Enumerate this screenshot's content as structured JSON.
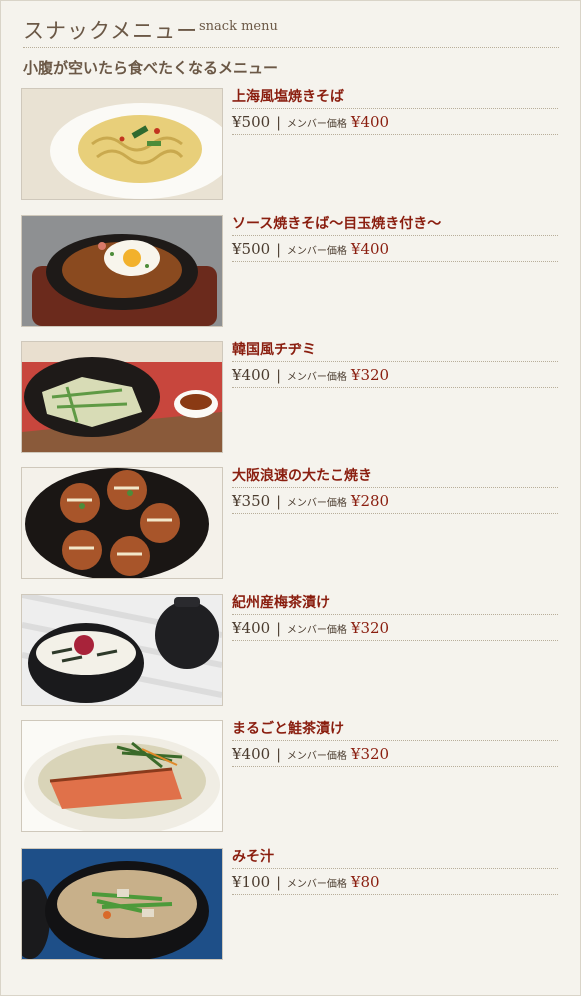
{
  "header": {
    "title_ja": "スナックメニュー",
    "title_en": "snack menu"
  },
  "section": {
    "title": "小腹が空いたら食べたくなるメニュー"
  },
  "member_label": "メンバー価格",
  "separator": "|",
  "items": [
    {
      "name": "上海風塩焼きそば",
      "price": "¥500",
      "member_price": "¥400",
      "image": "salt-yakisoba-photo"
    },
    {
      "name": "ソース焼きそば～目玉焼き付き～",
      "price": "¥500",
      "member_price": "¥400",
      "image": "sauce-yakisoba-photo"
    },
    {
      "name": "韓国風チヂミ",
      "price": "¥400",
      "member_price": "¥320",
      "image": "chijimi-photo"
    },
    {
      "name": "大阪浪速の大たこ焼き",
      "price": "¥350",
      "member_price": "¥280",
      "image": "takoyaki-photo"
    },
    {
      "name": "紀州産梅茶漬け",
      "price": "¥400",
      "member_price": "¥320",
      "image": "ume-chazuke-photo"
    },
    {
      "name": "まるごと鮭茶漬け",
      "price": "¥400",
      "member_price": "¥320",
      "image": "salmon-chazuke-photo"
    },
    {
      "name": "みそ汁",
      "price": "¥100",
      "member_price": "¥80",
      "image": "miso-soup-photo"
    }
  ]
}
